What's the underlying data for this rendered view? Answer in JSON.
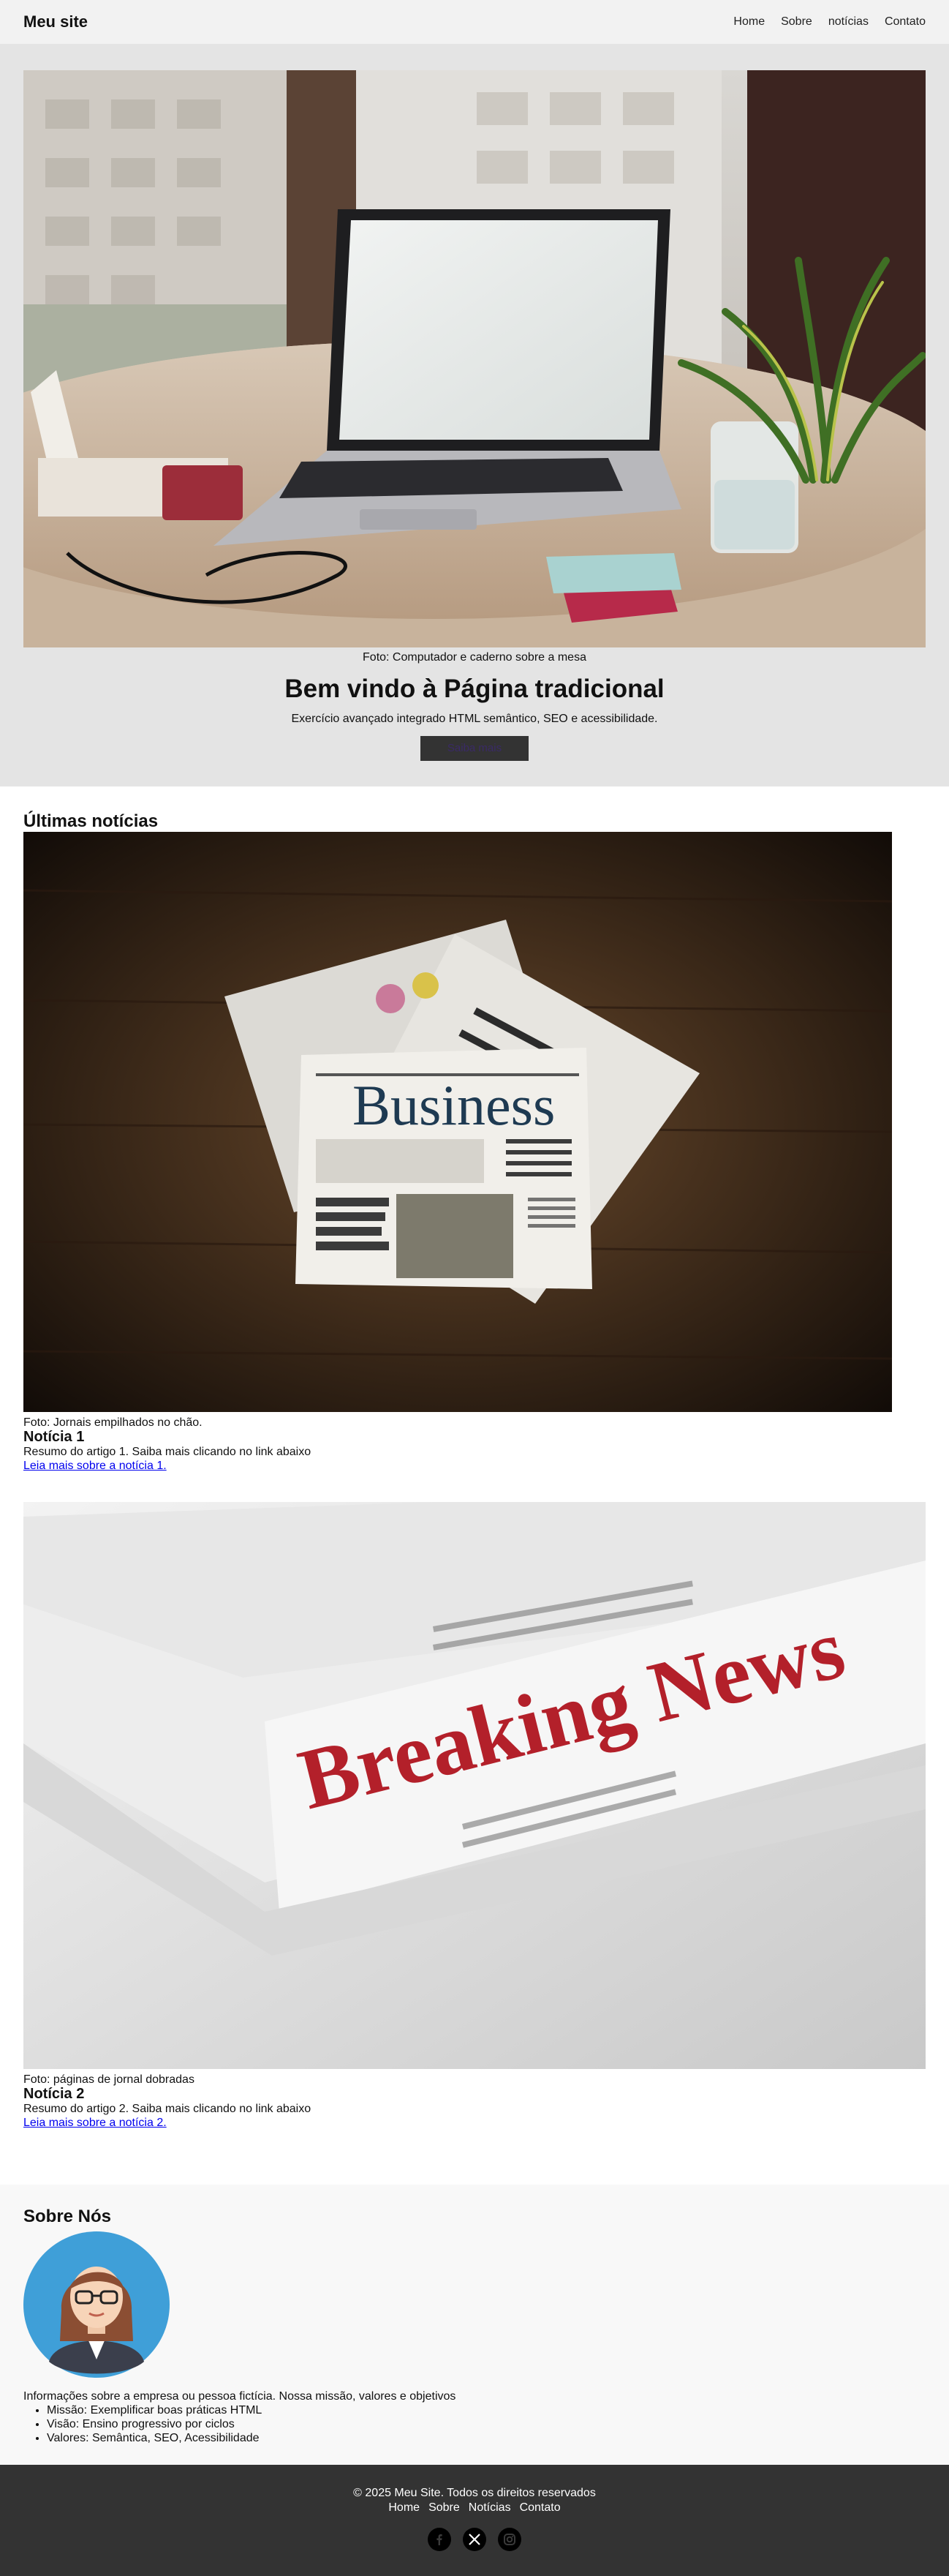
{
  "header": {
    "brand": "Meu site",
    "nav": [
      "Home",
      "Sobre",
      "notícias",
      "Contato"
    ]
  },
  "hero": {
    "caption": "Foto: Computador e caderno sobre a mesa",
    "title": "Bem vindo à Página tradicional",
    "subtitle": "Exercício avançado integrado HTML semântico, SEO e acessibilidade.",
    "cta_label": "Saiba mais"
  },
  "news": {
    "section_title": "Últimas notícias",
    "articles": [
      {
        "image_headline": "Business",
        "caption": "Foto: Jornais empilhados no chão.",
        "title": "Notícia 1",
        "summary": "Resumo do artigo 1. Saiba mais clicando no link abaixo",
        "link": "Leia mais sobre a notícia 1."
      },
      {
        "image_headline": "Breaking News",
        "caption": "Foto: páginas de jornal dobradas",
        "title": "Notícia 2",
        "summary": "Resumo do artigo 2. Saiba mais clicando no link abaixo",
        "link": "Leia mais sobre a notícia 2."
      }
    ]
  },
  "about": {
    "title": "Sobre Nós",
    "text": "Informações sobre a empresa ou pessoa fictícia. Nossa missão, valores e objetivos",
    "items": [
      "Missão: Exemplificar boas práticas HTML",
      "Visão: Ensino progressivo por ciclos",
      "Valores: Semântica, SEO, Acessibilidade"
    ]
  },
  "footer": {
    "copyright": "© 2025 Meu Site. Todos os direitos reservados",
    "nav": [
      "Home",
      "Sobre",
      "Notícias",
      "Contato"
    ],
    "social_icons": [
      "facebook-icon",
      "x-icon",
      "instagram-icon"
    ]
  },
  "colors": {
    "header_bg": "#f2f2f2",
    "hero_bg": "#e4e4e4",
    "button_bg": "#333333",
    "link": "#0000ee",
    "footer_bg": "#333333",
    "about_bg": "#f8f8f8"
  }
}
